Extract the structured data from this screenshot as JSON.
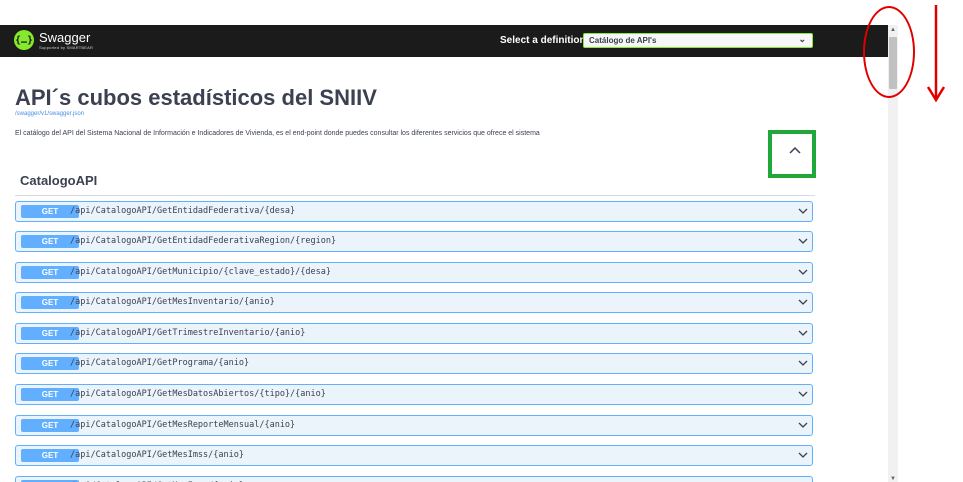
{
  "topbar": {
    "logo_glyph": "{…}",
    "logo_name": "Swagger",
    "logo_sub": "Supported by SMARTBEAR",
    "select_label": "Select a definition",
    "select_value": "Catálogo de API's",
    "brand_color": "#85ea2d"
  },
  "info": {
    "title": "API´s cubos estadísticos del SNIIV",
    "url": "/swagger/v1/swagger.json",
    "description": "El catálogo del API del Sistema Nacional de Información e Indicadores de Vivienda, es el end-point donde puedes consultar los diferentes servicios que ofrece el sistema"
  },
  "tag": {
    "name": "CatalogoAPI",
    "expanded": true
  },
  "operations": [
    {
      "method": "GET",
      "path": "/api/CatalogoAPI/GetEntidadFederativa/{desa}"
    },
    {
      "method": "GET",
      "path": "/api/CatalogoAPI/GetEntidadFederativaRegion/{region}"
    },
    {
      "method": "GET",
      "path": "/api/CatalogoAPI/GetMunicipio/{clave_estado}/{desa}"
    },
    {
      "method": "GET",
      "path": "/api/CatalogoAPI/GetMesInventario/{anio}"
    },
    {
      "method": "GET",
      "path": "/api/CatalogoAPI/GetTrimestreInventario/{anio}"
    },
    {
      "method": "GET",
      "path": "/api/CatalogoAPI/GetPrograma/{anio}"
    },
    {
      "method": "GET",
      "path": "/api/CatalogoAPI/GetMesDatosAbiertos/{tipo}/{anio}"
    },
    {
      "method": "GET",
      "path": "/api/CatalogoAPI/GetMesReporteMensual/{anio}"
    },
    {
      "method": "GET",
      "path": "/api/CatalogoAPI/GetMesImss/{anio}"
    },
    {
      "method": "GET",
      "path": "/api/CatalogoAPI/GetMesImss/{anio}"
    }
  ],
  "colors": {
    "get_method": "#61affe",
    "get_background": "#ebf3fb",
    "annotation_red": "#e00000",
    "annotation_green": "#21a83b"
  }
}
